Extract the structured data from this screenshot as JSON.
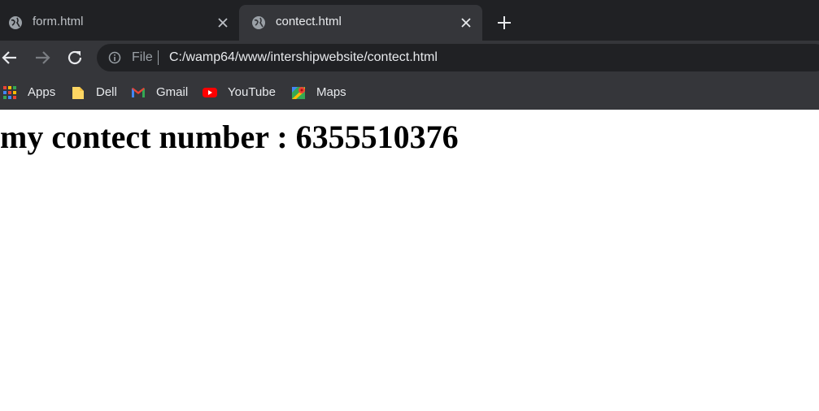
{
  "tabs": [
    {
      "title": "form.html",
      "icon": "globe-icon",
      "active": false
    },
    {
      "title": "contect.html",
      "icon": "globe-icon",
      "active": true
    }
  ],
  "omnibox": {
    "scheme_label": "File",
    "url": "C:/wamp64/www/intershipwebsite/contect.html"
  },
  "bookmarks": [
    {
      "label": "Apps",
      "icon": "apps-grid-icon"
    },
    {
      "label": "Dell",
      "icon": "folder-icon"
    },
    {
      "label": "Gmail",
      "icon": "gmail-icon"
    },
    {
      "label": "YouTube",
      "icon": "youtube-icon"
    },
    {
      "label": "Maps",
      "icon": "maps-icon"
    }
  ],
  "page": {
    "heading": "my contect number : 6355510376"
  },
  "colors": {
    "tabstrip_bg": "#202124",
    "toolbar_bg": "#35363a",
    "omnibox_bg": "#202124",
    "text_light": "#e8eaed",
    "text_dim": "#9aa0a6",
    "page_bg": "#ffffff"
  }
}
